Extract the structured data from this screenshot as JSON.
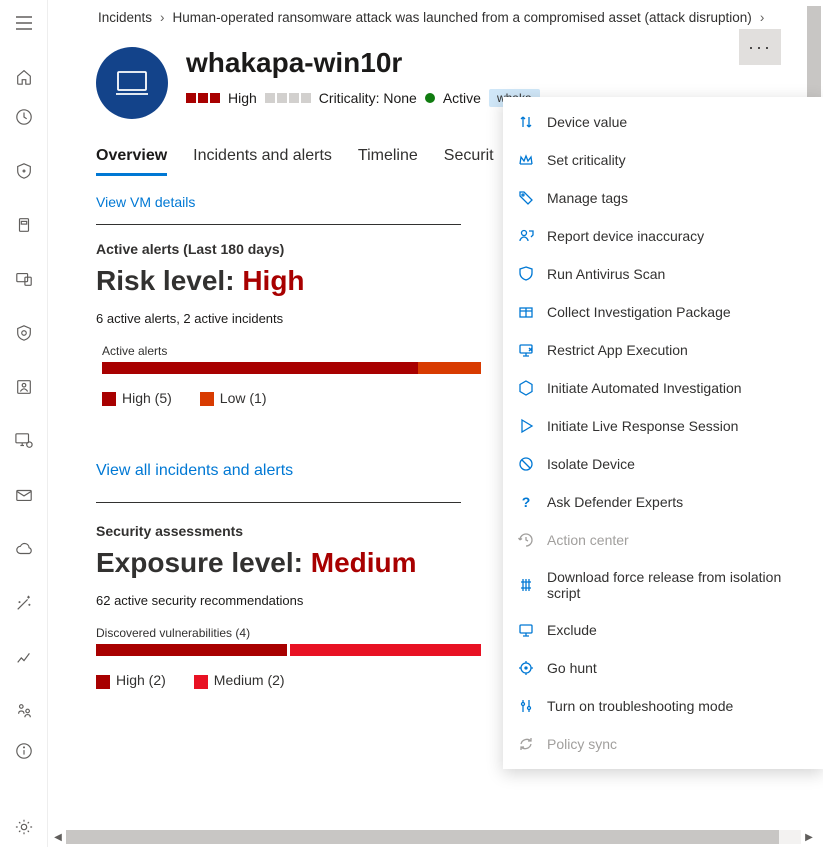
{
  "breadcrumb": {
    "root": "Incidents",
    "incident": "Human-operated ransomware attack was launched from a compromised asset (attack disruption)"
  },
  "device": {
    "name": "whakapa-win10r",
    "risk_label": "High",
    "criticality_label": "Criticality: None",
    "status_label": "Active",
    "tag": "whaka"
  },
  "tabs": {
    "overview": "Overview",
    "incidents": "Incidents and alerts",
    "timeline": "Timeline",
    "security": "Securit"
  },
  "view_vm": "View VM details",
  "alerts_section": {
    "label": "Active alerts (Last 180 days)",
    "title_prefix": "Risk level: ",
    "title_value": "High",
    "subline": "6 active alerts, 2 active incidents",
    "chart_label": "Active alerts",
    "legend_high": "High (5)",
    "legend_low": "Low (1)"
  },
  "view_alerts": "View all incidents and alerts",
  "assessments_section": {
    "label": "Security assessments",
    "title_prefix": "Exposure level: ",
    "title_value": "Medium",
    "subline": "62 active security recommendations",
    "chart_label": "Discovered vulnerabilities (4)",
    "legend_high": "High (2)",
    "legend_medium": "Medium (2)"
  },
  "menu": {
    "device_value": "Device value",
    "set_criticality": "Set criticality",
    "manage_tags": "Manage tags",
    "report_inaccuracy": "Report device inaccuracy",
    "antivirus": "Run Antivirus Scan",
    "investigation_pkg": "Collect Investigation Package",
    "restrict_app": "Restrict App Execution",
    "auto_investigation": "Initiate Automated Investigation",
    "live_response": "Initiate Live Response Session",
    "isolate": "Isolate Device",
    "ask_experts": "Ask Defender Experts",
    "action_center": "Action center",
    "download_script": "Download force release from isolation script",
    "exclude": "Exclude",
    "go_hunt": "Go hunt",
    "troubleshooting": "Turn on troubleshooting mode",
    "policy_sync": "Policy sync"
  },
  "colors": {
    "high": "#a80000",
    "low": "#d83b01",
    "medium_bar": "#e81123",
    "link": "#0078d4"
  },
  "chart_data": [
    {
      "type": "bar",
      "title": "Active alerts",
      "orientation": "horizontal-stacked",
      "categories": [
        "Active alerts"
      ],
      "series": [
        {
          "name": "High",
          "values": [
            5
          ],
          "color": "#a80000"
        },
        {
          "name": "Low",
          "values": [
            1
          ],
          "color": "#d83b01"
        }
      ],
      "total": 6
    },
    {
      "type": "bar",
      "title": "Discovered vulnerabilities (4)",
      "orientation": "horizontal-stacked",
      "categories": [
        "Discovered vulnerabilities"
      ],
      "series": [
        {
          "name": "High",
          "values": [
            2
          ],
          "color": "#a80000"
        },
        {
          "name": "Medium",
          "values": [
            2
          ],
          "color": "#e81123"
        }
      ],
      "total": 4
    }
  ]
}
